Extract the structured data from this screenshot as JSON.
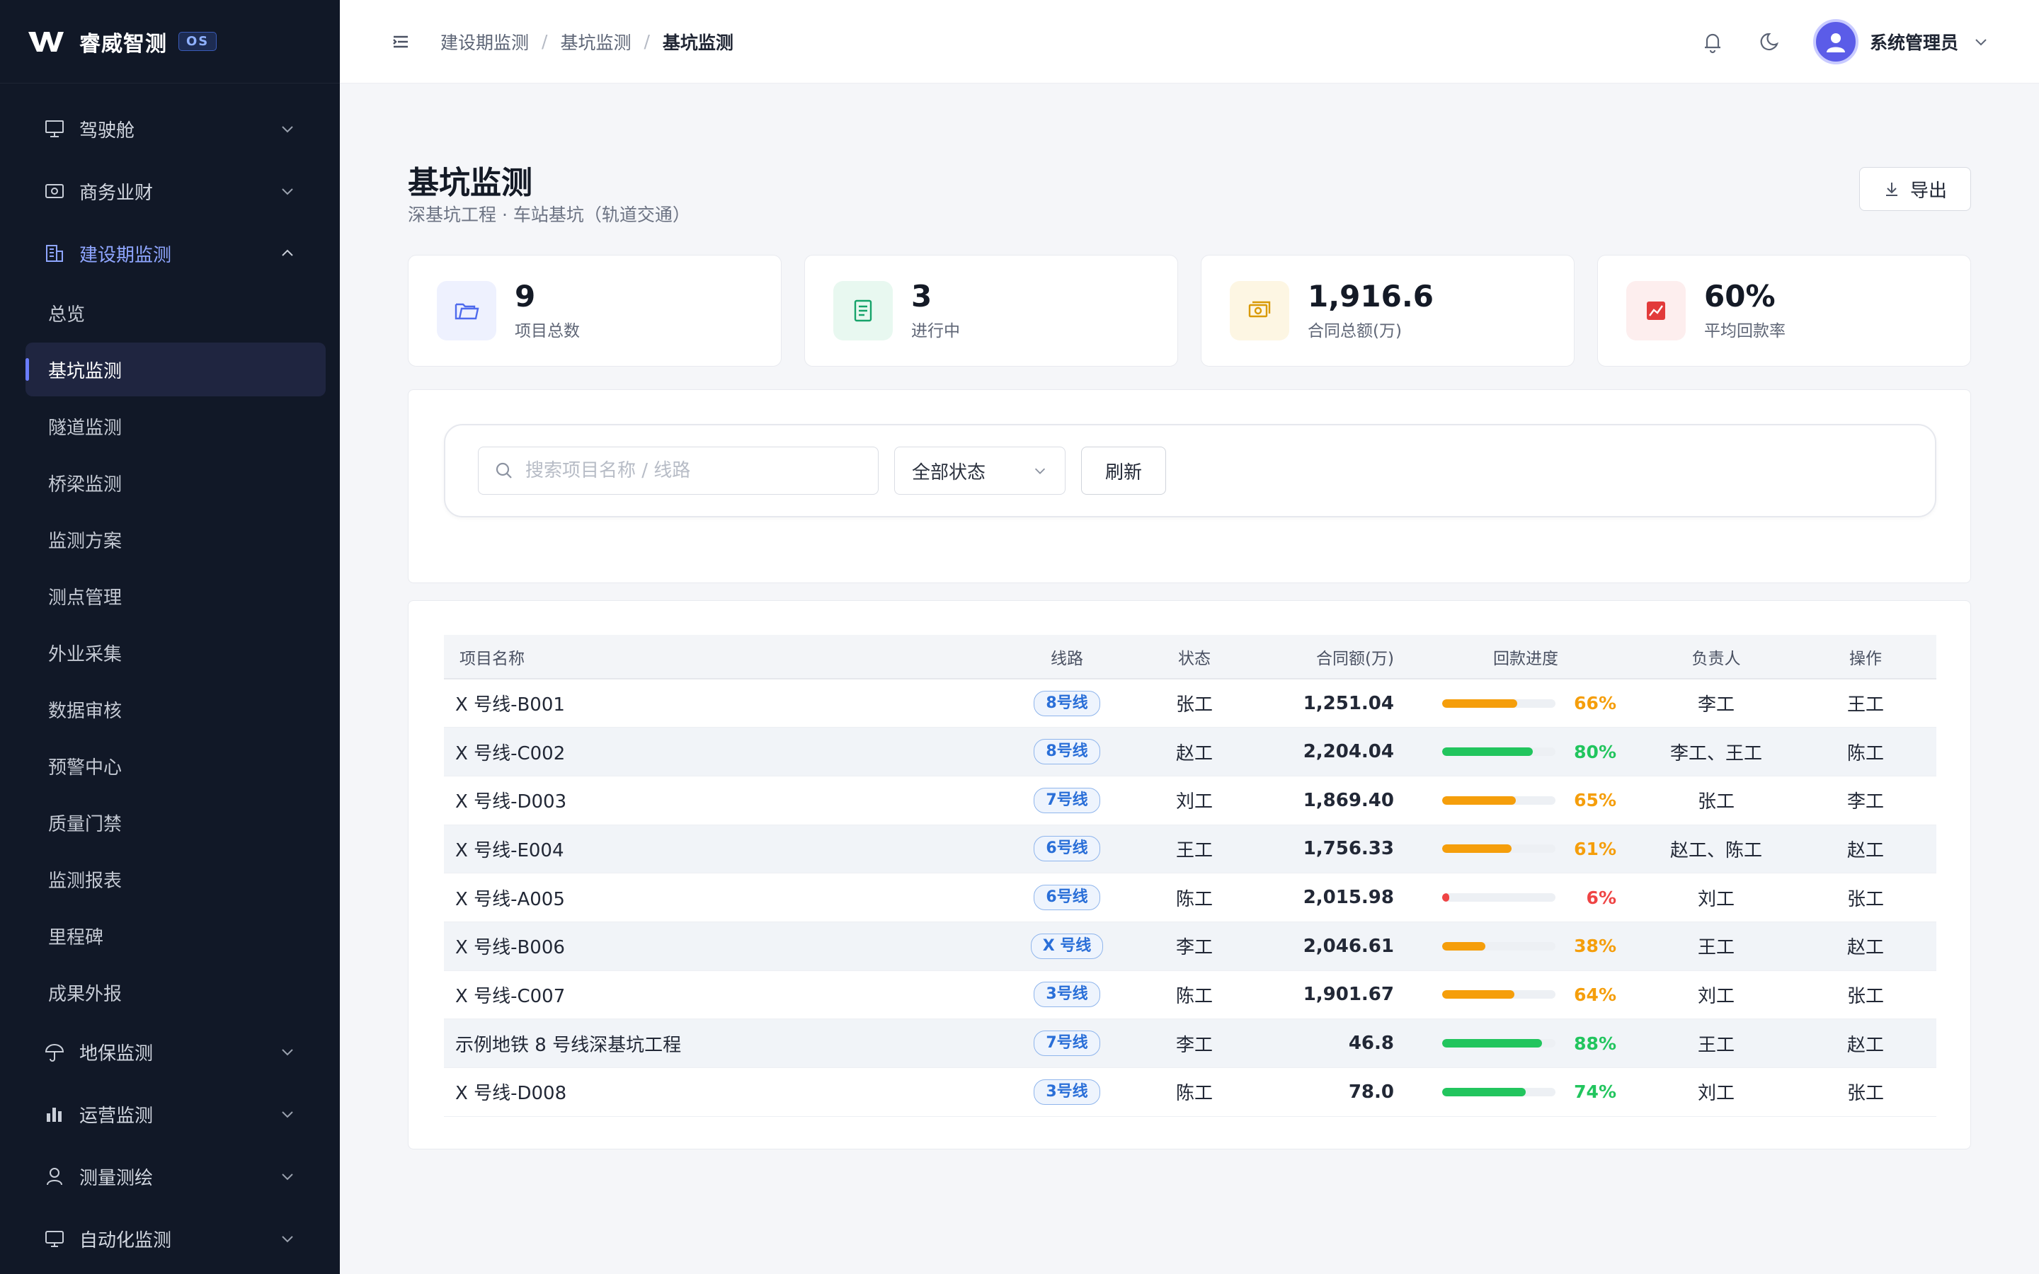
{
  "brand": {
    "name": "睿威智测",
    "badge": "OS"
  },
  "sidebar": {
    "groups_top": [
      {
        "label": "驾驶舱",
        "icon": "presentation-icon"
      },
      {
        "label": "商务业财",
        "icon": "money-icon"
      }
    ],
    "open_group": {
      "label": "建设期监测",
      "icon": "building-icon"
    },
    "sub_items": [
      "总览",
      "基坑监测",
      "隧道监测",
      "桥梁监测",
      "监测方案",
      "测点管理",
      "外业采集",
      "数据审核",
      "预警中心",
      "质量门禁",
      "监测报表",
      "里程碑",
      "成果外报"
    ],
    "active_sub": 1,
    "groups_bottom": [
      {
        "label": "地保监测",
        "icon": "umbrella-icon"
      },
      {
        "label": "运营监测",
        "icon": "bar-chart-icon"
      },
      {
        "label": "测量测绘",
        "icon": "location-person-icon"
      },
      {
        "label": "自动化监测",
        "icon": "monitor-icon"
      }
    ]
  },
  "topbar": {
    "breadcrumb": [
      "建设期监测",
      "基坑监测",
      "基坑监测"
    ],
    "user": "系统管理员"
  },
  "page": {
    "title": "基坑监测",
    "subtitle": "深基坑工程 · 车站基坑（轨道交通）",
    "export_label": "导出"
  },
  "stats": [
    {
      "value": "9",
      "label": "项目总数",
      "color": "#4f6bed",
      "bg": "#eef1fe",
      "icon": "folder-icon"
    },
    {
      "value": "3",
      "label": "进行中",
      "color": "#16a36a",
      "bg": "#e8f8f0",
      "icon": "document-icon"
    },
    {
      "value": "1,916.6",
      "label": "合同总额(万)",
      "color": "#d99a06",
      "bg": "#fdf6e3",
      "icon": "money-icon"
    },
    {
      "value": "60%",
      "label": "平均回款率",
      "color": "#e23b3b",
      "bg": "#fdeeee",
      "icon": "trend-chart-icon"
    }
  ],
  "filters": {
    "search_placeholder": "搜索项目名称 / 线路",
    "status_select": "全部状态",
    "refresh_label": "刷新"
  },
  "table": {
    "columns": [
      "项目名称",
      "线路",
      "状态",
      "合同额(万)",
      "回款进度",
      "负责人",
      "操作"
    ],
    "rows": [
      {
        "name": "X 号线-B001",
        "line": "8号线",
        "status": "张工",
        "amount": "1,251.04",
        "progress": 66,
        "pct": "66%",
        "manager": "李工",
        "op": "王工"
      },
      {
        "name": "X 号线-C002",
        "line": "8号线",
        "status": "赵工",
        "amount": "2,204.04",
        "progress": 80,
        "pct": "80%",
        "manager": "李工、王工",
        "op": "陈工"
      },
      {
        "name": "X 号线-D003",
        "line": "7号线",
        "status": "刘工",
        "amount": "1,869.40",
        "progress": 65,
        "pct": "65%",
        "manager": "张工",
        "op": "李工"
      },
      {
        "name": "X 号线-E004",
        "line": "6号线",
        "status": "王工",
        "amount": "1,756.33",
        "progress": 61,
        "pct": "61%",
        "manager": "赵工、陈工",
        "op": "赵工"
      },
      {
        "name": "X 号线-A005",
        "line": "6号线",
        "status": "陈工",
        "amount": "2,015.98",
        "progress": 6,
        "pct": "6%",
        "manager": "刘工",
        "op": "张工"
      },
      {
        "name": "X 号线-B006",
        "line": "X 号线",
        "status": "李工",
        "amount": "2,046.61",
        "progress": 38,
        "pct": "38%",
        "manager": "王工",
        "op": "赵工"
      },
      {
        "name": "X 号线-C007",
        "line": "3号线",
        "status": "陈工",
        "amount": "1,901.67",
        "progress": 64,
        "pct": "64%",
        "manager": "刘工",
        "op": "张工"
      },
      {
        "name": "示例地铁 8 号线深基坑工程",
        "line": "7号线",
        "status": "李工",
        "amount": "46.8",
        "progress": 88,
        "pct": "88%",
        "manager": "王工",
        "op": "赵工"
      },
      {
        "name": "X 号线-D008",
        "line": "3号线",
        "status": "陈工",
        "amount": "78.0",
        "progress": 74,
        "pct": "74%",
        "manager": "刘工",
        "op": "张工"
      }
    ],
    "progress_colors": {
      "high": "#22c55e",
      "mid": "#f59e0b",
      "low": "#ef4444"
    }
  }
}
